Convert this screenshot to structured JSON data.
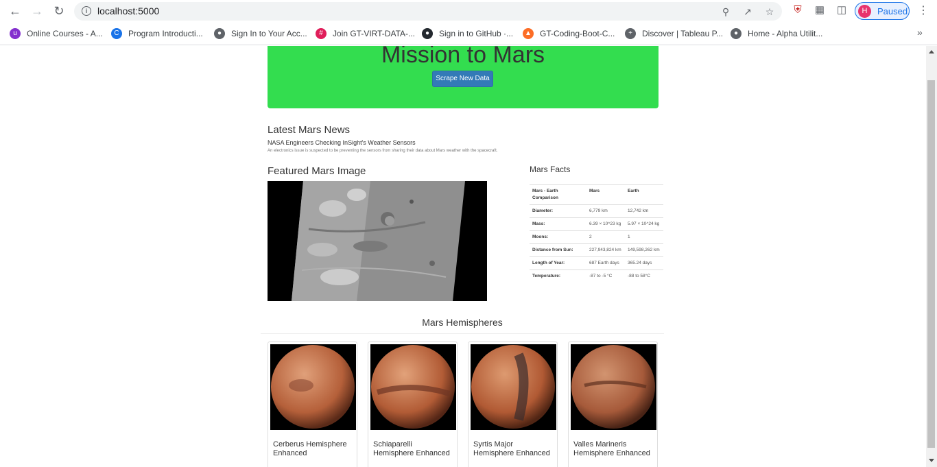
{
  "browser": {
    "url": "localhost:5000",
    "profile_initial": "H",
    "profile_status": "Paused",
    "bookmarks": [
      {
        "label": "Online Courses - A...",
        "icon": "online-courses-icon",
        "color": "#8430ce"
      },
      {
        "label": "Program Introducti...",
        "icon": "program-intro-icon",
        "color": "#1a73e8"
      },
      {
        "label": "Sign In to Your Acc...",
        "icon": "globe-icon",
        "color": "#5f6368"
      },
      {
        "label": "Join GT-VIRT-DATA-...",
        "icon": "slack-icon",
        "color": "#e01e5a"
      },
      {
        "label": "Sign in to GitHub ·...",
        "icon": "github-icon",
        "color": "#24292f"
      },
      {
        "label": "GT-Coding-Boot-C...",
        "icon": "gitlab-icon",
        "color": "#fc6d26"
      },
      {
        "label": "Discover | Tableau P...",
        "icon": "tableau-icon",
        "color": "#5f6368"
      },
      {
        "label": "Home - Alpha Utilit...",
        "icon": "globe-icon",
        "color": "#5f6368"
      }
    ]
  },
  "page": {
    "title": "Mission to Mars",
    "scrape_button": "Scrape New Data",
    "news": {
      "heading": "Latest Mars News",
      "title": "NASA Engineers Checking InSight's Weather Sensors",
      "paragraph": "An electronics issue is suspected to be preventing the sensors from sharing their data about Mars weather with the spacecraft."
    },
    "featured": {
      "heading": "Featured Mars Image"
    },
    "facts": {
      "heading": "Mars Facts",
      "columns": [
        "Mars - Earth Comparison",
        "Mars",
        "Earth"
      ],
      "rows": [
        [
          "Diameter:",
          "6,779 km",
          "12,742 km"
        ],
        [
          "Mass:",
          "6.39 × 10^23 kg",
          "5.97 × 10^24 kg"
        ],
        [
          "Moons:",
          "2",
          "1"
        ],
        [
          "Distance from Sun:",
          "227,943,824 km",
          "149,598,262 km"
        ],
        [
          "Length of Year:",
          "687 Earth days",
          "365.24 days"
        ],
        [
          "Temperature:",
          "-87 to -5 °C",
          "-88 to 58°C"
        ]
      ]
    },
    "hemispheres": {
      "heading": "Mars Hemispheres",
      "items": [
        {
          "title": "Cerberus Hemisphere Enhanced",
          "color": "#c8764a"
        },
        {
          "title": "Schiaparelli Hemisphere Enhanced",
          "color": "#c46f45"
        },
        {
          "title": "Syrtis Major Hemisphere Enhanced",
          "color": "#bf6a3e"
        },
        {
          "title": "Valles Marineris Hemisphere Enhanced",
          "color": "#b7663f"
        }
      ]
    }
  }
}
